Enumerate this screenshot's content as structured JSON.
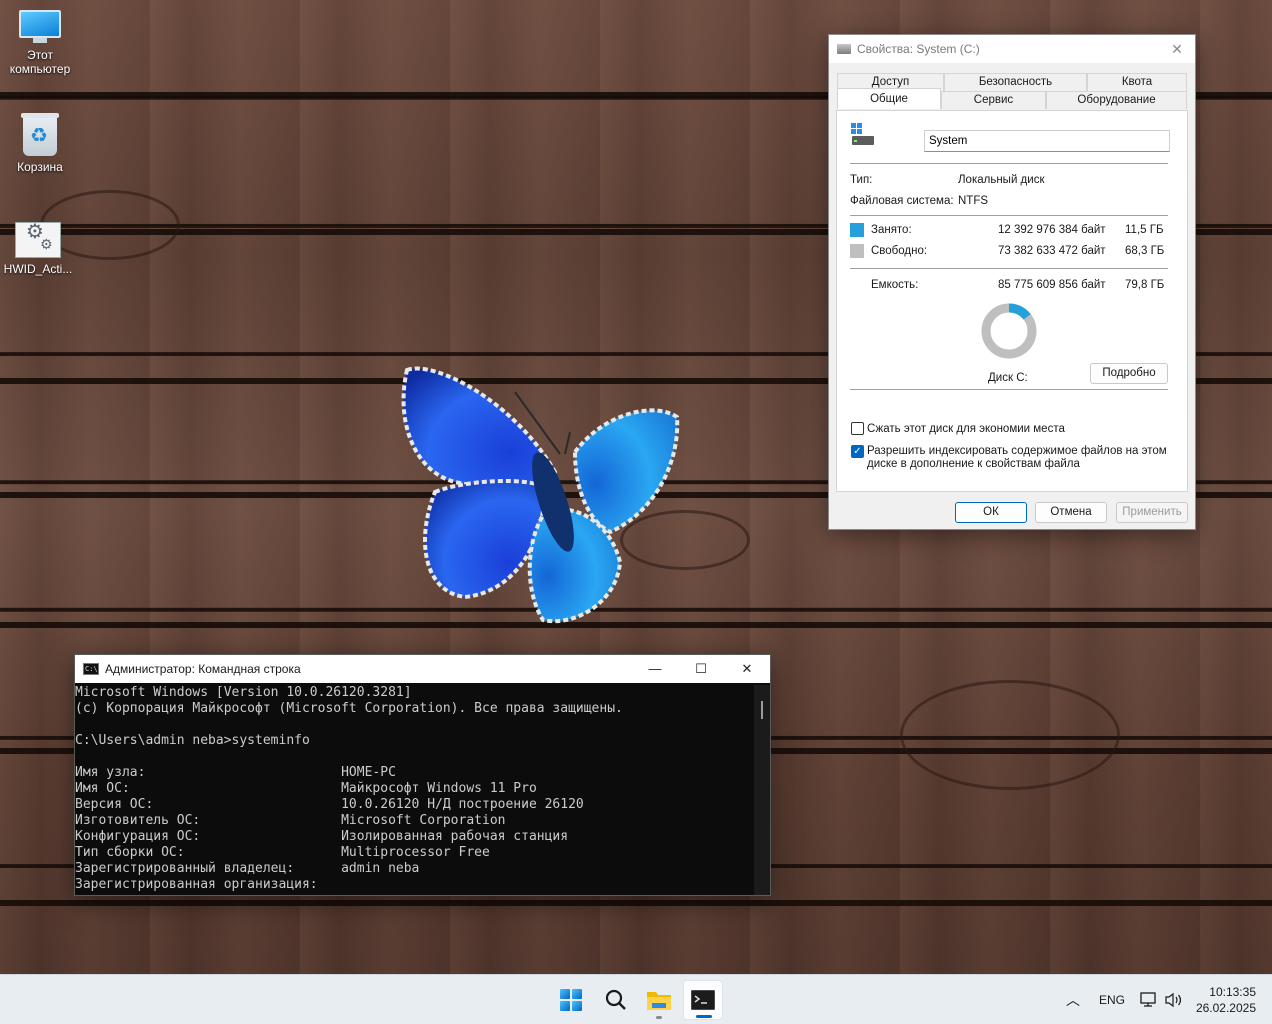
{
  "desktop": {
    "icons": [
      {
        "label": "Этот\nкомпьютер",
        "icon": "this-pc-icon"
      },
      {
        "label": "Корзина",
        "icon": "recycle-bin-icon"
      },
      {
        "label": "HWID_Acti...",
        "icon": "settings-file-icon"
      }
    ]
  },
  "properties": {
    "title": "Свойства: System (C:)",
    "tabs_row1": [
      "Доступ",
      "Безопасность",
      "Квота"
    ],
    "tabs_row2": [
      "Общие",
      "Сервис",
      "Оборудование"
    ],
    "active_tab": "Общие",
    "name_value": "System",
    "type_label": "Тип:",
    "type_value": "Локальный диск",
    "fs_label": "Файловая система:",
    "fs_value": "NTFS",
    "used_label": "Занято:",
    "used_bytes": "12 392 976 384 байт",
    "used_gb": "11,5 ГБ",
    "free_label": "Свободно:",
    "free_bytes": "73 382 633 472 байт",
    "free_gb": "68,3 ГБ",
    "capacity_label": "Емкость:",
    "capacity_bytes": "85 775 609 856 байт",
    "capacity_gb": "79,8 ГБ",
    "used_fraction": 0.1445,
    "disk_label": "Диск C:",
    "details_button": "Подробно",
    "compress_label": "Сжать этот диск для экономии места",
    "compress_checked": false,
    "index_label_1": "Разрешить индексировать содержимое файлов на этом",
    "index_label_2": "диске в дополнение к свойствам файла",
    "index_checked": true,
    "ok_button": "ОК",
    "cancel_button": "Отмена",
    "apply_button": "Применить",
    "colors": {
      "used": "#26a0da",
      "free": "#bfbfbf",
      "accent": "#0067c0"
    }
  },
  "cmd": {
    "title": "Администратор: Командная строка",
    "lines": [
      "Microsoft Windows [Version 10.0.26120.3281]",
      "(c) Корпорация Майкрософт (Microsoft Corporation). Все права защищены.",
      "",
      "C:\\Users\\admin neba>systeminfo",
      "",
      "Имя узла:                         HOME-PC",
      "Имя ОС:                           Майкрософт Windows 11 Pro",
      "Версия ОС:                        10.0.26120 Н/Д построение 26120",
      "Изготовитель ОС:                  Microsoft Corporation",
      "Конфигурация ОС:                  Изолированная рабочая станция",
      "Тип сборки ОС:                    Multiprocessor Free",
      "Зарегистрированный владелец:      admin neba",
      "Зарегистрированная организация:"
    ]
  },
  "taskbar": {
    "apps": [
      "start-icon",
      "search-icon",
      "file-explorer-icon",
      "terminal-icon"
    ],
    "language": "ENG",
    "time": "10:13:35",
    "date": "26.02.2025"
  }
}
